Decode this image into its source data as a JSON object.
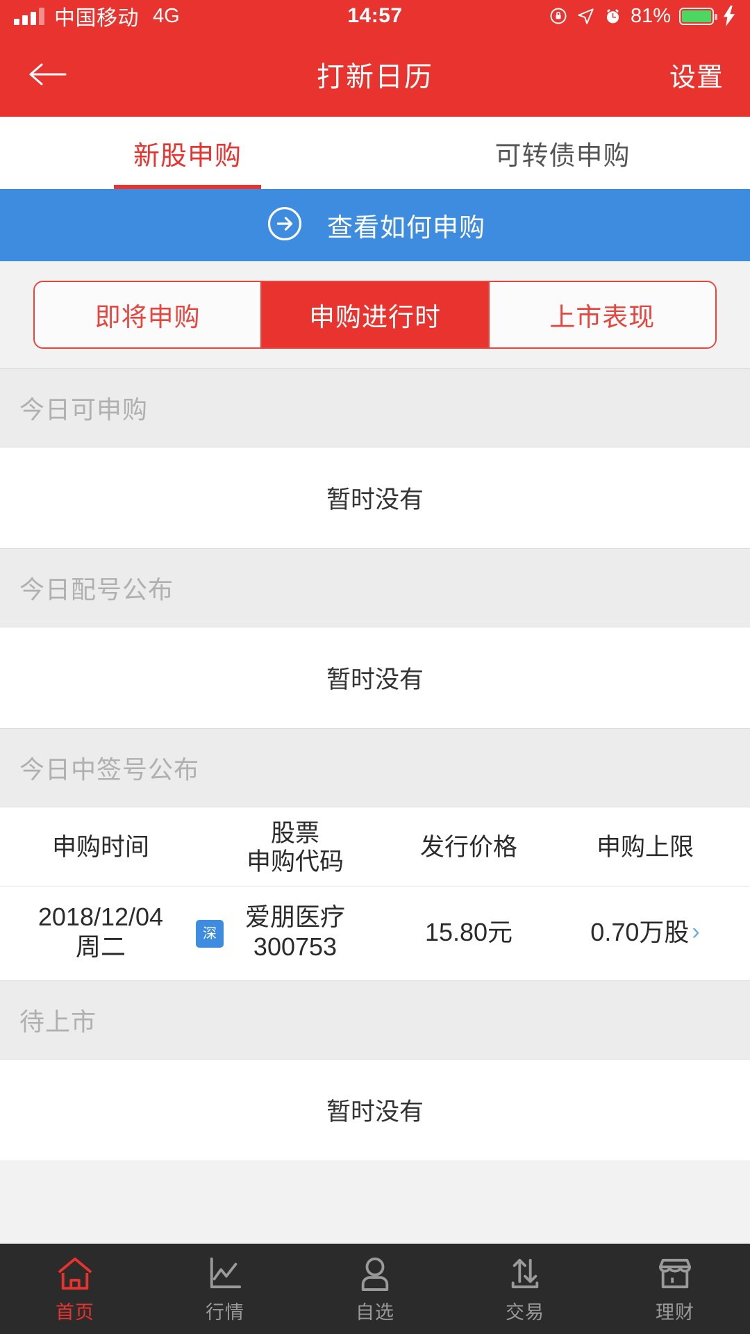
{
  "status_bar": {
    "carrier": "中国移动",
    "network": "4G",
    "time": "14:57",
    "battery_percent": "81%",
    "icons": [
      "signal-bars-icon",
      "rotation-lock-icon",
      "location-arrow-icon",
      "alarm-clock-icon",
      "battery-icon",
      "charging-bolt-icon"
    ]
  },
  "nav": {
    "back_icon": "back-arrow-icon",
    "title": "打新日历",
    "action": "设置"
  },
  "tabs": [
    {
      "label": "新股申购",
      "active": true
    },
    {
      "label": "可转债申购",
      "active": false
    }
  ],
  "banner": {
    "icon": "arrow-right-circle-icon",
    "text": "查看如何申购"
  },
  "segments": [
    {
      "label": "即将申购",
      "active": false
    },
    {
      "label": "申购进行时",
      "active": true
    },
    {
      "label": "上市表现",
      "active": false
    }
  ],
  "sections": [
    {
      "title": "今日可申购",
      "empty_text": "暂时没有"
    },
    {
      "title": "今日配号公布",
      "empty_text": "暂时没有"
    },
    {
      "title": "今日中签号公布"
    },
    {
      "title": "待上市",
      "empty_text": "暂时没有"
    }
  ],
  "table": {
    "headers": {
      "time": "申购时间",
      "stock_l1": "股票",
      "stock_l2": "申购代码",
      "price": "发行价格",
      "limit": "申购上限"
    },
    "rows": [
      {
        "date": "2018/12/04",
        "weekday": "周二",
        "market_badge": "深",
        "stock_name": "爱朋医疗",
        "stock_code": "300753",
        "issue_price": "15.80元",
        "purchase_limit": "0.70万股",
        "chevron": "›"
      }
    ]
  },
  "bottom_nav": [
    {
      "label": "首页",
      "icon": "home-icon",
      "active": true
    },
    {
      "label": "行情",
      "icon": "chart-line-icon",
      "active": false
    },
    {
      "label": "自选",
      "icon": "person-icon",
      "active": false
    },
    {
      "label": "交易",
      "icon": "transfer-arrows-icon",
      "active": false
    },
    {
      "label": "理财",
      "icon": "store-icon",
      "active": false
    }
  ],
  "colors": {
    "brand_red": "#e8332e",
    "banner_blue": "#3d8ce0",
    "badge_blue": "#3d8ce0",
    "tabbar_dark": "#2b2b2b",
    "battery_green": "#4cd763"
  }
}
